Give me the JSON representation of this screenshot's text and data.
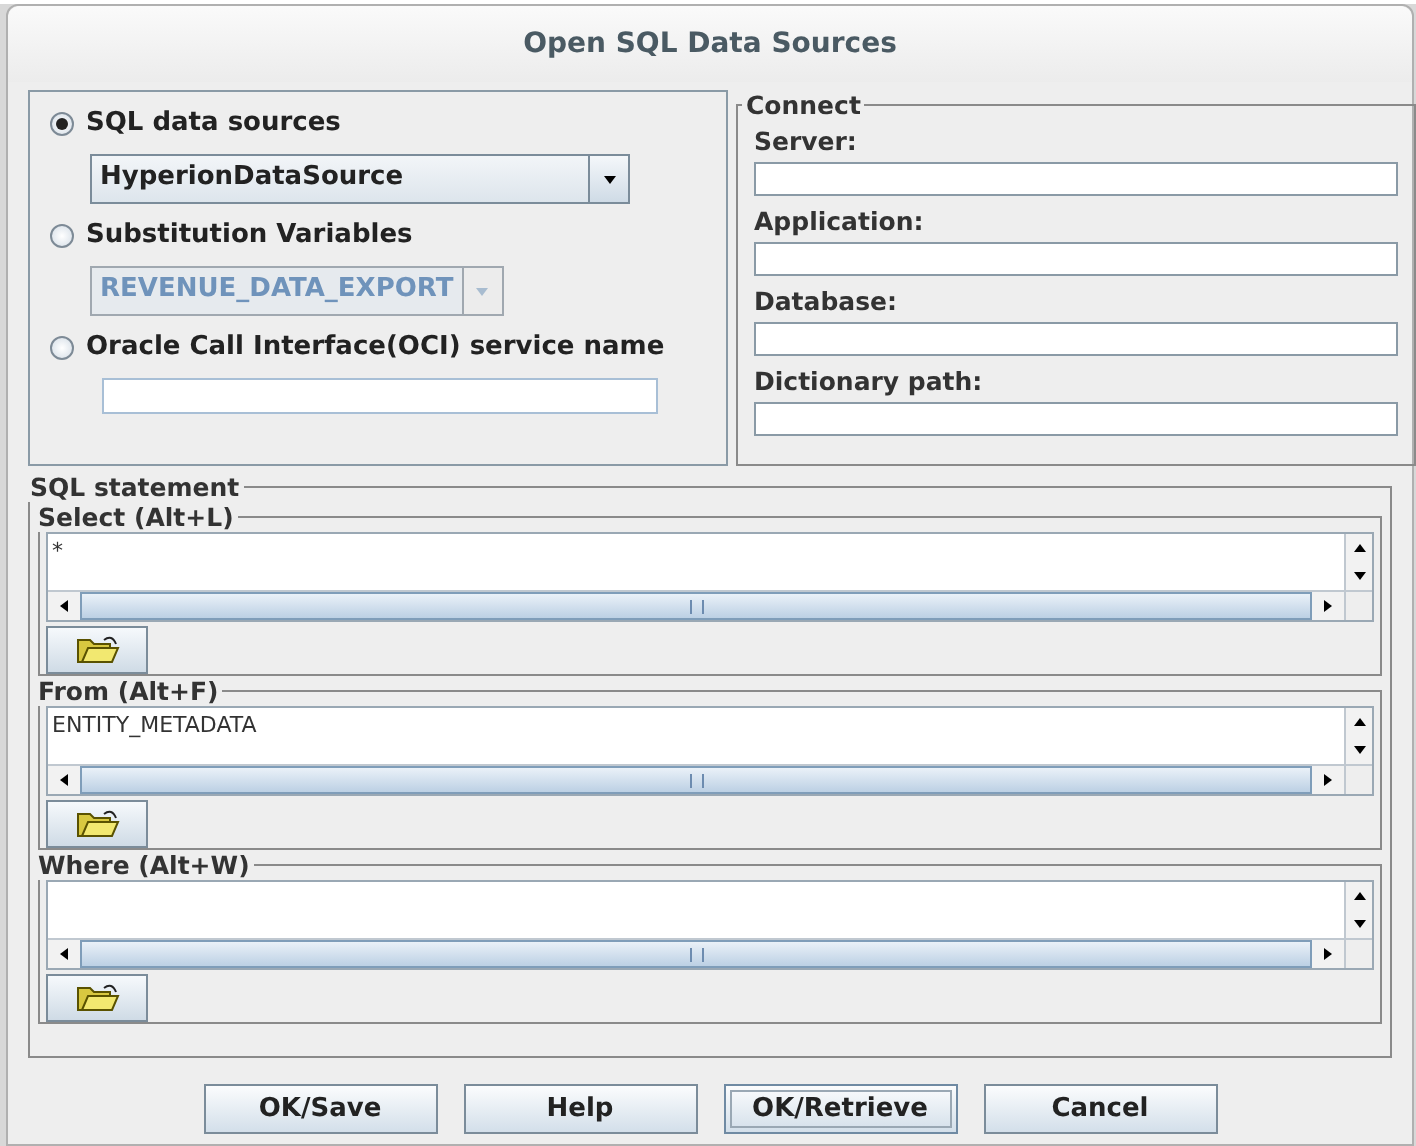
{
  "window": {
    "title": "Open SQL Data Sources"
  },
  "source": {
    "options": [
      {
        "kind": "combo",
        "label": "SQL data sources",
        "selected": true,
        "value": "HyperionDataSource",
        "disabled": false
      },
      {
        "kind": "combo",
        "label": "Substitution Variables",
        "selected": false,
        "value": "REVENUE_DATA_EXPORT",
        "disabled": true
      },
      {
        "kind": "text",
        "label": "Oracle Call Interface(OCI) service name",
        "selected": false
      }
    ]
  },
  "connect": {
    "title": "Connect",
    "fields": [
      {
        "label": "Server:"
      },
      {
        "label": "Application:"
      },
      {
        "label": "Database:"
      },
      {
        "label": "Dictionary path:"
      }
    ]
  },
  "sql_statement": {
    "title": "SQL statement",
    "clauses": [
      {
        "label": "Select (Alt+L)",
        "value": "*"
      },
      {
        "label": "From (Alt+F)",
        "value": "ENTITY_METADATA"
      },
      {
        "label": "Where (Alt+W)"
      }
    ]
  },
  "buttons": [
    {
      "label": "OK/Save",
      "focused": false
    },
    {
      "label": "Help",
      "focused": false
    },
    {
      "label": "OK/Retrieve",
      "focused": true
    },
    {
      "label": "Cancel",
      "focused": false
    }
  ]
}
